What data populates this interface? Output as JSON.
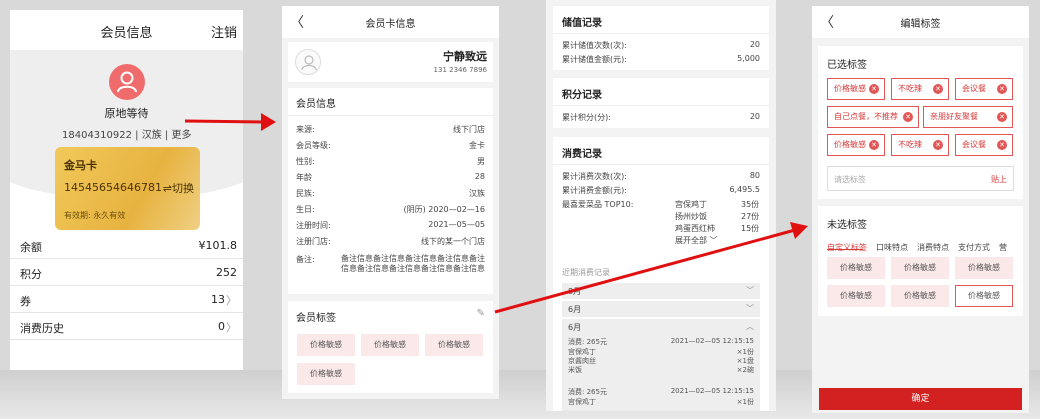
{
  "colors": {
    "brand_red": "#d32020",
    "tag_bg": "#fbe9e9",
    "gold_card": "#e7b340"
  },
  "screen1": {
    "title": "会员信息",
    "logout": "注销",
    "member_name": "原地等待",
    "member_info": "18404310922 | 汉族 | 更多",
    "card": {
      "name": "金马卡",
      "number": "14545654646781",
      "switch": "⇌切换",
      "expiry": "有效期: 永久有效"
    },
    "rows": [
      {
        "label": "余额",
        "value": "¥101.8"
      },
      {
        "label": "积分",
        "value": "252"
      },
      {
        "label": "券",
        "value": "13"
      },
      {
        "label": "消费历史",
        "value": "0"
      }
    ]
  },
  "screen2": {
    "title": "会员卡信息",
    "name": "宁静致远",
    "phone": "131 2346 7896",
    "info_heading": "会员信息",
    "fields": [
      {
        "k": "来源:",
        "v": "线下门店"
      },
      {
        "k": "会员等级:",
        "v": "金卡"
      },
      {
        "k": "性别:",
        "v": "男"
      },
      {
        "k": "年龄",
        "v": "28"
      },
      {
        "k": "民族:",
        "v": "汉族"
      },
      {
        "k": "生日:",
        "v": "(阴历)  2020—02—16"
      },
      {
        "k": "注册时间:",
        "v": "2021—05—05"
      },
      {
        "k": "注册门店:",
        "v": "线下的某一个门店"
      }
    ],
    "note_label": "备注:",
    "note_value": "备注信息备注信息备注信息备注信息备注信息备注信息备注信息备注信息备注信息",
    "tags_heading": "会员标签",
    "tags": [
      "价格敏感",
      "价格敏感",
      "价格敏感",
      "价格敏感"
    ]
  },
  "screen3": {
    "stored": {
      "heading": "储值记录",
      "rows": [
        {
          "k": "累计储值次数(次):",
          "v": "20"
        },
        {
          "k": "累计储值金额(元):",
          "v": "5,000"
        }
      ]
    },
    "points": {
      "heading": "积分记录",
      "rows": [
        {
          "k": "累计积分(分):",
          "v": "20"
        }
      ]
    },
    "consume": {
      "heading": "消费记录",
      "rows": [
        {
          "k": "累计消费次数(次):",
          "v": "80"
        },
        {
          "k": "累计消费金额(元):",
          "v": "6,495.5"
        }
      ],
      "top10_label": "最喜爱菜品  TOP10:",
      "dishes": [
        {
          "name": "宫保鸡丁",
          "count": "35份"
        },
        {
          "name": "扬州炒饭",
          "count": "27份"
        },
        {
          "name": "鸡蛋西红柿",
          "count": "15份"
        }
      ],
      "expand": "展开全部",
      "recent_label": "近期消费记录",
      "months": [
        "8月",
        "6月",
        "6月"
      ],
      "txns": [
        {
          "amount": "消费:  265元",
          "time": "2021—02—05  12:15:15",
          "items": [
            {
              "n": "宫保鸡丁",
              "q": "×1份"
            },
            {
              "n": "京酱肉丝",
              "q": "×1盘"
            },
            {
              "n": "米饭",
              "q": "×2碗"
            }
          ]
        },
        {
          "amount": "消费:  265元",
          "time": "2021—02—05  12:15:15",
          "items": [
            {
              "n": "宫保鸡丁",
              "q": "×1份"
            }
          ]
        }
      ]
    }
  },
  "screen4": {
    "title": "编辑标签",
    "selected_heading": "已选标签",
    "selected_tags": [
      "价格敏感",
      "不吃辣",
      "会议餐",
      "自己点餐，不推荐",
      "亲朋好友聚餐",
      "价格敏感",
      "不吃辣",
      "会议餐"
    ],
    "input_placeholder": "请选标签",
    "paste": "贴上",
    "unselected_heading": "未选标签",
    "tabs": [
      "自定义标签",
      "口味特点",
      "消费特点",
      "支付方式",
      "营"
    ],
    "unselected_tags": [
      "价格敏感",
      "价格敏感",
      "价格敏感",
      "价格敏感",
      "价格敏感",
      "价格敏感"
    ],
    "confirm": "确定"
  }
}
